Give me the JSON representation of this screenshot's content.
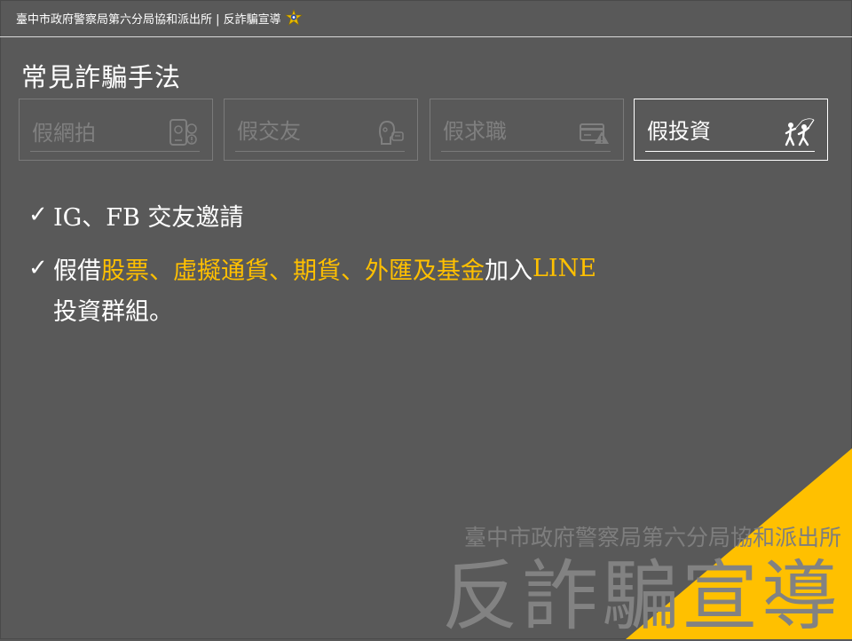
{
  "header": {
    "title": "臺中市政府警察局第六分局協和派出所 | 反詐騙宣導",
    "badge_icon": "police-badge-icon"
  },
  "page": {
    "title": "常見詐騙手法"
  },
  "tabs": [
    {
      "label": "假網拍",
      "icon": "phone-shopping-icon",
      "active": false
    },
    {
      "label": "假交友",
      "icon": "person-chat-icon",
      "active": false
    },
    {
      "label": "假求職",
      "icon": "card-warning-icon",
      "active": false
    },
    {
      "label": "假投資",
      "icon": "people-fishing-icon",
      "active": true
    }
  ],
  "content": {
    "bullet1": {
      "check": "✓",
      "text": "IG、FB 交友邀請"
    },
    "bullet2": {
      "check": "✓",
      "prefix": "假借",
      "highlight": "股票、虛擬通貨、期貨、外匯及基金",
      "suffix": "加入",
      "tail": "LINE",
      "continuation": "投資群組。"
    }
  },
  "watermark": {
    "sub": "臺中市政府警察局第六分局協和派出所",
    "main": "反詐騙宣導"
  },
  "colors": {
    "background": "#595959",
    "accent": "#ffc000",
    "inactive": "#7f7f7f",
    "text": "#ffffff"
  }
}
